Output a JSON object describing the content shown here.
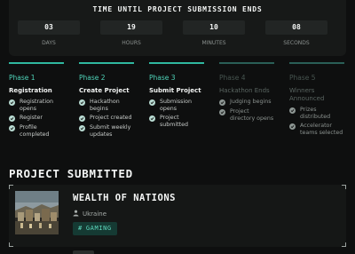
{
  "countdown": {
    "title": "TIME UNTIL PROJECT SUBMISSION ENDS",
    "values": [
      {
        "value": "03",
        "unit": "DAYS"
      },
      {
        "value": "19",
        "unit": "HOURS"
      },
      {
        "value": "10",
        "unit": "MINUTES"
      },
      {
        "value": "08",
        "unit": "SECONDS"
      }
    ]
  },
  "phases": [
    {
      "number": "Phase 1",
      "name": "Registration",
      "active": true,
      "items": [
        "Registration opens",
        "Register",
        "Profile completed"
      ]
    },
    {
      "number": "Phase 2",
      "name": "Create Project",
      "active": true,
      "items": [
        "Hackathon begins",
        "Project created",
        "Submit weekly updates"
      ]
    },
    {
      "number": "Phase 3",
      "name": "Submit Project",
      "active": true,
      "items": [
        "Submission opens",
        "Project submitted"
      ]
    },
    {
      "number": "Phase 4",
      "name": "Hackathon Ends",
      "active": false,
      "items": [
        "Judging begins",
        "Project directory opens"
      ]
    },
    {
      "number": "Phase 5",
      "name": "Winners Announced",
      "active": false,
      "items": [
        "Prizes distributed",
        "Accelerator teams selected"
      ]
    }
  ],
  "submitted": {
    "title": "PROJECT SUBMITTED",
    "project": {
      "name": "WEALTH OF NATIONS",
      "location": "Ukraine",
      "tag": "GAMING",
      "icons": {
        "location": "person-pin-icon",
        "tag": "hash-icon"
      }
    }
  },
  "colors": {
    "accent": "#2fb8a0",
    "background": "#0e0f0f",
    "tag_bg": "#153a33"
  }
}
